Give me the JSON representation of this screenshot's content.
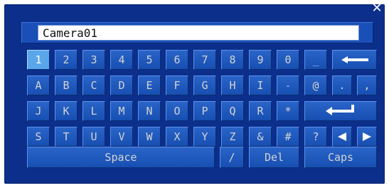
{
  "dialog": {
    "close_icon": "close-icon"
  },
  "input": {
    "value": "Camera01",
    "placeholder": ""
  },
  "keyboard": {
    "row1": [
      "1",
      "2",
      "3",
      "4",
      "5",
      "6",
      "7",
      "8",
      "9",
      "0",
      "_"
    ],
    "row2": [
      "A",
      "B",
      "C",
      "D",
      "E",
      "F",
      "G",
      "H",
      "I",
      "-",
      "@",
      ".",
      ","
    ],
    "row3": [
      "J",
      "K",
      "L",
      "M",
      "N",
      "O",
      "P",
      "Q",
      "R",
      "*"
    ],
    "row4": [
      "S",
      "T",
      "U",
      "V",
      "W",
      "X",
      "Y",
      "Z",
      "&",
      "#",
      "?"
    ],
    "actions": {
      "space": "Space",
      "slash": "/",
      "del": "Del",
      "caps": "Caps"
    },
    "selected_key": "1",
    "icons": {
      "backspace": "backspace-arrow-icon",
      "enter": "enter-arrow-icon",
      "left": "left-arrow-icon",
      "right": "right-arrow-icon"
    }
  },
  "colors": {
    "panel": "#0b2f8a",
    "key": "#1f5bc0",
    "selected_key": "#5aa6ea",
    "text": "#d3d3d3"
  }
}
